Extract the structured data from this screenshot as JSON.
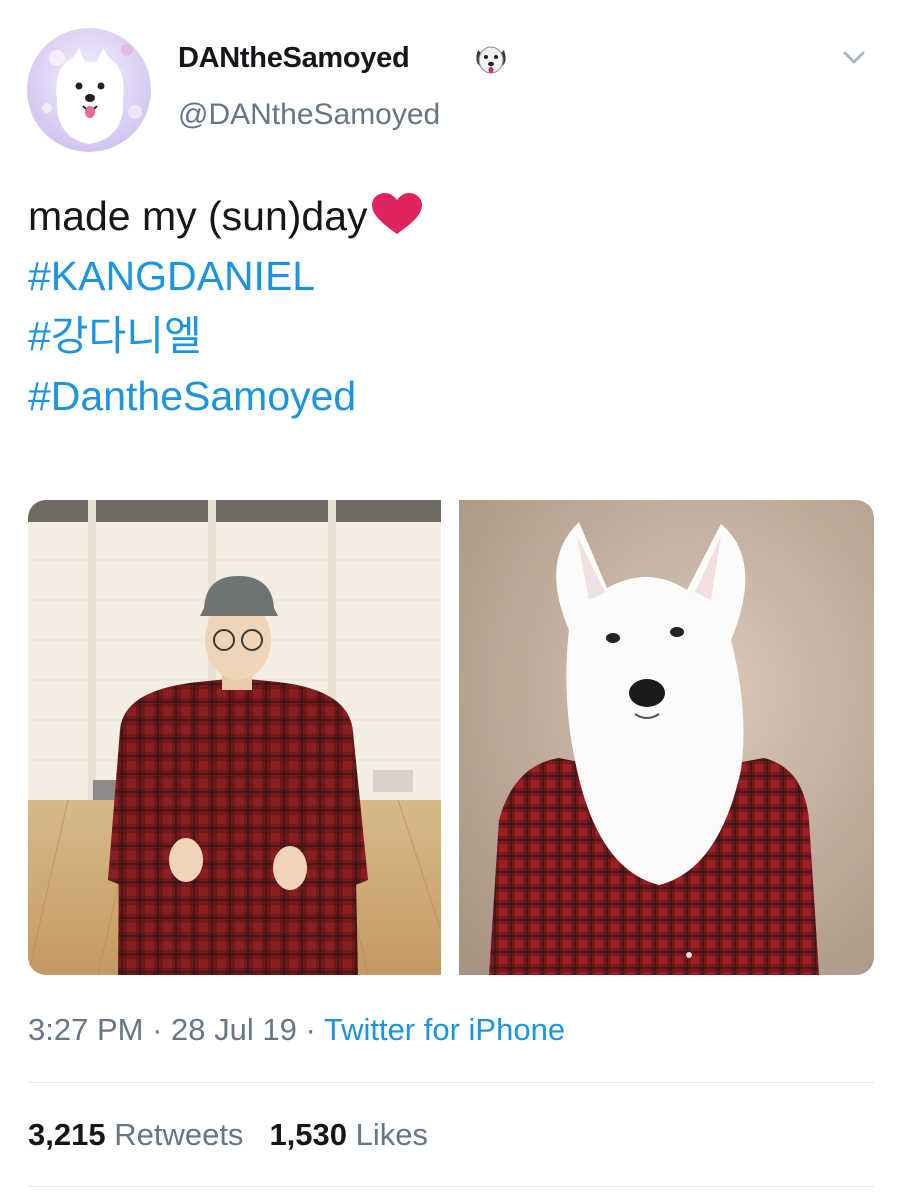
{
  "author": {
    "display_name": "DANtheSamoyed",
    "emoji_icon": "dog-face-icon",
    "handle": "@DANtheSamoyed",
    "avatar_icon": "samoyed-avatar"
  },
  "tweet": {
    "text_line1": "made my (sun)day",
    "heart_icon": "red-heart-icon",
    "hashtags": [
      "#KANGDANIEL",
      "#강다니엘",
      "#DantheSamoyed"
    ]
  },
  "media": {
    "left_photo": "man-in-plaid-shirt-photo",
    "right_photo": "samoyed-in-plaid-shirt-photo"
  },
  "meta": {
    "time": "3:27 PM",
    "separator": " · ",
    "date": "28 Jul 19",
    "source": "Twitter for iPhone"
  },
  "stats": {
    "retweets_count": "3,215",
    "retweets_label": "Retweets",
    "likes_count": "1,530",
    "likes_label": "Likes"
  },
  "colors": {
    "link": "#1b95e0",
    "secondary_text": "#657786",
    "primary_text": "#14171a",
    "heart": "#e0245e"
  }
}
